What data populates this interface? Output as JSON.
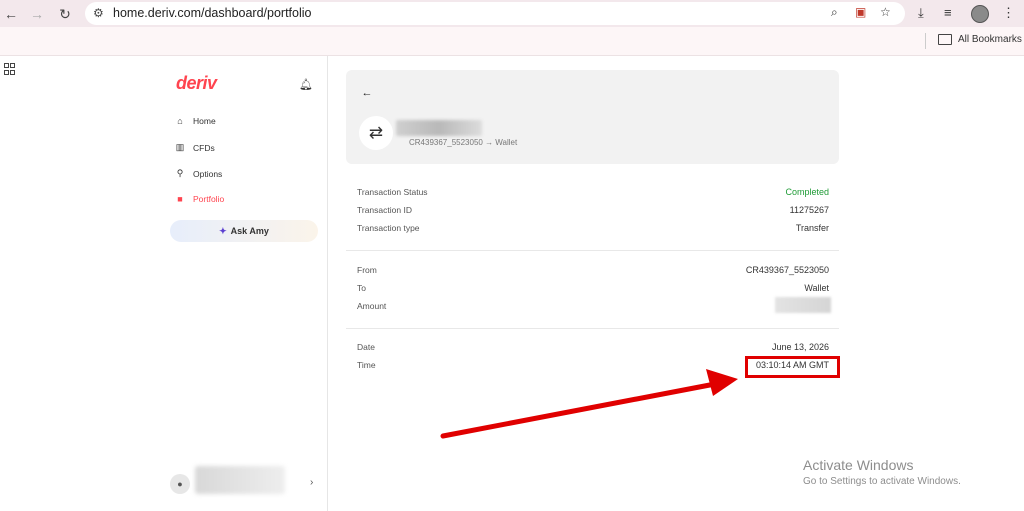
{
  "browser": {
    "url": "home.deriv.com/dashboard/portfolio",
    "all_bookmarks": "All Bookmarks"
  },
  "sidebar": {
    "logo": "deriv",
    "items": [
      {
        "label": "Home",
        "icon": "home-icon"
      },
      {
        "label": "CFDs",
        "icon": "chart-icon"
      },
      {
        "label": "Options",
        "icon": "options-icon"
      },
      {
        "label": "Portfolio",
        "icon": "wallet-icon",
        "active": true
      }
    ],
    "ask_label": "Ask Amy"
  },
  "header": {
    "route": "CR439367_5523050 → Wallet"
  },
  "details": {
    "status_label": "Transaction Status",
    "status_value": "Completed",
    "id_label": "Transaction ID",
    "id_value": "11275267",
    "type_label": "Transaction type",
    "type_value": "Transfer",
    "from_label": "From",
    "from_value": "CR439367_5523050",
    "to_label": "To",
    "to_value": "Wallet",
    "amount_label": "Amount",
    "date_label": "Date",
    "date_value": "June 13, 2026",
    "time_label": "Time",
    "time_value": "03:10:14 AM GMT"
  },
  "watermark": {
    "title": "Activate Windows",
    "subtitle": "Go to Settings to activate Windows."
  },
  "colors": {
    "brand": "#ff444f",
    "success": "#1f9b36",
    "highlight": "#e00000"
  }
}
